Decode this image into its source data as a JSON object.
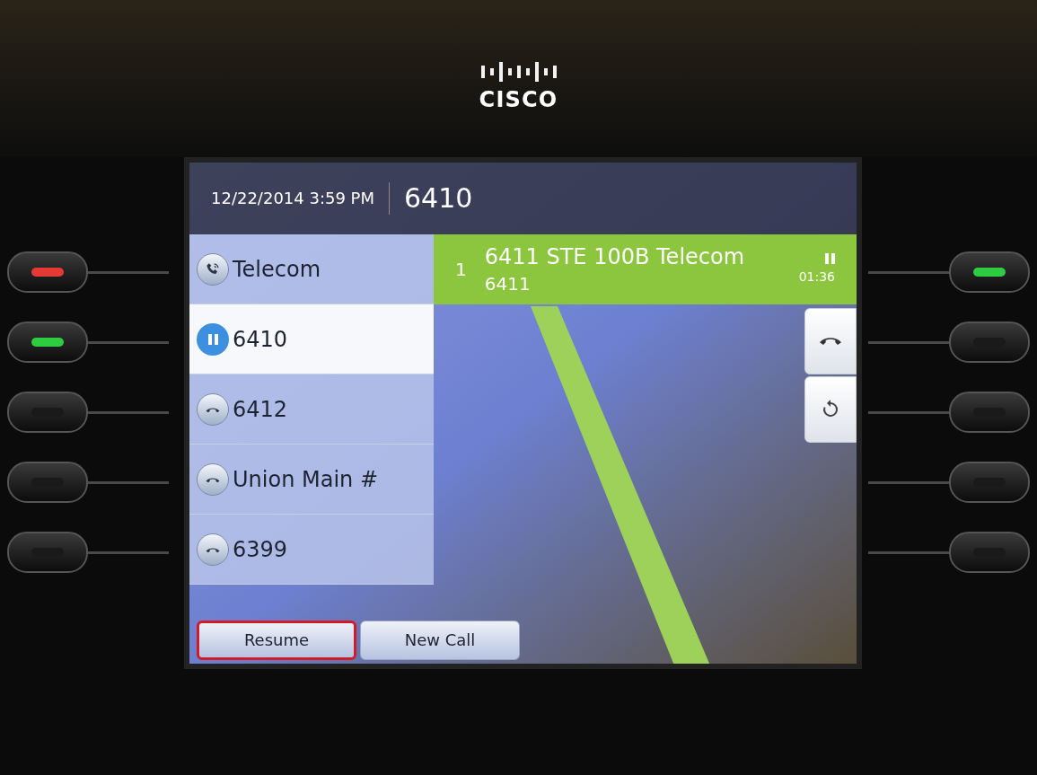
{
  "brand": {
    "logo_text": "CISCO"
  },
  "header": {
    "datetime": "12/22/2014 3:59 PM",
    "extension": "6410"
  },
  "lines": [
    {
      "kind": "shared",
      "label": "Telecom",
      "selected": false
    },
    {
      "kind": "hold",
      "label": "6410",
      "selected": true
    },
    {
      "kind": "idle",
      "label": "6412",
      "selected": false
    },
    {
      "kind": "idle",
      "label": "Union Main #",
      "selected": false
    },
    {
      "kind": "idle",
      "label": "6399",
      "selected": false
    }
  ],
  "active_call": {
    "index": "1",
    "title": "6411 STE 100B Telecom",
    "number": "6411",
    "on_hold": true,
    "duration": "01:36"
  },
  "side_buttons": [
    {
      "kind": "end"
    },
    {
      "kind": "redial"
    }
  ],
  "softkeys": [
    {
      "label": "Resume",
      "highlighted": true
    },
    {
      "label": "New Call",
      "highlighted": false
    }
  ],
  "left_keys": [
    {
      "lit": true,
      "color": "#e53935"
    },
    {
      "lit": true,
      "color": "#2ecc40"
    },
    {
      "lit": false
    },
    {
      "lit": false
    },
    {
      "lit": false
    }
  ],
  "right_keys": [
    {
      "lit": true,
      "color": "#2ecc40"
    },
    {
      "lit": false
    },
    {
      "lit": false
    },
    {
      "lit": false
    },
    {
      "lit": false
    }
  ]
}
